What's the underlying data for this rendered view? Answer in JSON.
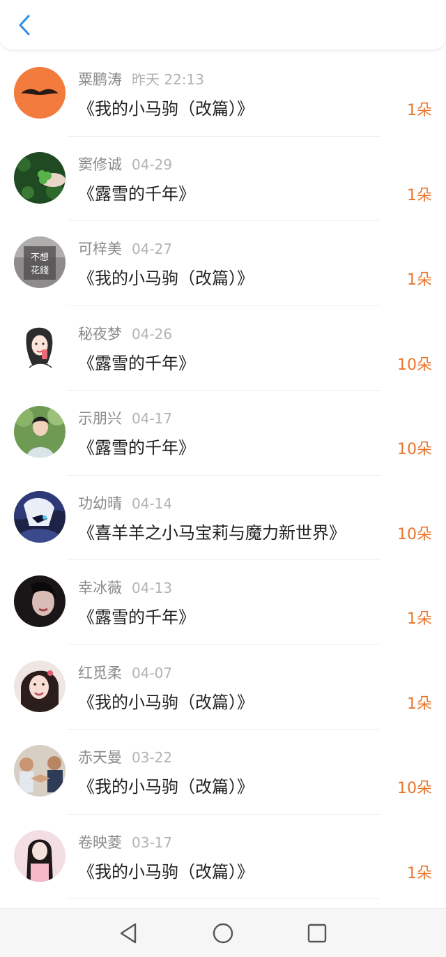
{
  "header": {
    "back_icon": "chevron-left-icon",
    "accent": "#2b8ee8"
  },
  "items": [
    {
      "name": "粟鹏涛",
      "date": "昨天 22:13",
      "title": "《我的小马驹（改篇）》",
      "count": "1朵",
      "avatar": "mustache-avatar"
    },
    {
      "name": "窦修诚",
      "date": "04-29",
      "title": "《露雪的千年》",
      "count": "1朵",
      "avatar": "clover-avatar"
    },
    {
      "name": "可梓美",
      "date": "04-27",
      "title": "《我的小马驹（改篇）》",
      "count": "1朵",
      "avatar": "text-avatar",
      "avatar_text": [
        "不想",
        "花錢"
      ]
    },
    {
      "name": "秘夜梦",
      "date": "04-26",
      "title": "《露雪的千年》",
      "count": "10朵",
      "avatar": "girl-drawing-avatar"
    },
    {
      "name": "示朋兴",
      "date": "04-17",
      "title": "《露雪的千年》",
      "count": "10朵",
      "avatar": "photo-avatar"
    },
    {
      "name": "功幼晴",
      "date": "04-14",
      "title": "《喜羊羊之小马宝莉与魔力新世界》",
      "count": "10朵",
      "avatar": "anime-avatar"
    },
    {
      "name": "幸冰薇",
      "date": "04-13",
      "title": "《露雪的千年》",
      "count": "1朵",
      "avatar": "dark-photo-avatar"
    },
    {
      "name": "红觅柔",
      "date": "04-07",
      "title": "《我的小马驹（改篇）》",
      "count": "1朵",
      "avatar": "selfie-avatar"
    },
    {
      "name": "赤天曼",
      "date": "03-22",
      "title": "《我的小马驹（改篇）》",
      "count": "10朵",
      "avatar": "arm-wrestle-avatar"
    },
    {
      "name": "卷映菱",
      "date": "03-17",
      "title": "《我的小马驹（改篇）》",
      "count": "1朵",
      "avatar": "pink-photo-avatar"
    }
  ],
  "navbar": {
    "back": "triangle-back-icon",
    "home": "circle-home-icon",
    "recent": "square-recent-icon"
  },
  "colors": {
    "count": "#e9752b",
    "name": "#8a8a8a",
    "date": "#b3b3b3",
    "title": "#1f1f1f"
  }
}
